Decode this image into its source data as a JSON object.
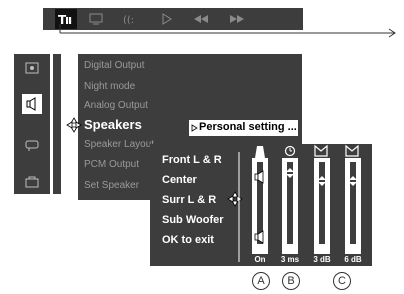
{
  "list_menu": {
    "items": [
      "Digital Output",
      "Night mode",
      "Analog Output",
      "Speakers",
      "Speaker Layout",
      "PCM Output",
      "Set Speaker"
    ],
    "active_index": 3,
    "selected_value": "Personal setting ..."
  },
  "speaker_menu": {
    "items": [
      "Front L & R",
      "Center",
      "Surr L & R",
      "Sub Woofer",
      "OK to exit"
    ],
    "slider_captions": [
      "On",
      "3 ms",
      "3 dB",
      "6 dB"
    ]
  },
  "callouts": [
    "A",
    "B",
    "C"
  ],
  "icons": {
    "top_bar": [
      "settings-icon",
      "display-icon",
      "audio-icon",
      "play-icon",
      "rewind-icon",
      "forward-icon"
    ],
    "left_menu": [
      "picture-icon",
      "speaker-icon",
      "subtitle-icon",
      "folder-icon"
    ]
  },
  "colors": {
    "panel": "#3d3d3d",
    "text_dim": "#9a9a9a",
    "highlight": "#ffffff"
  }
}
